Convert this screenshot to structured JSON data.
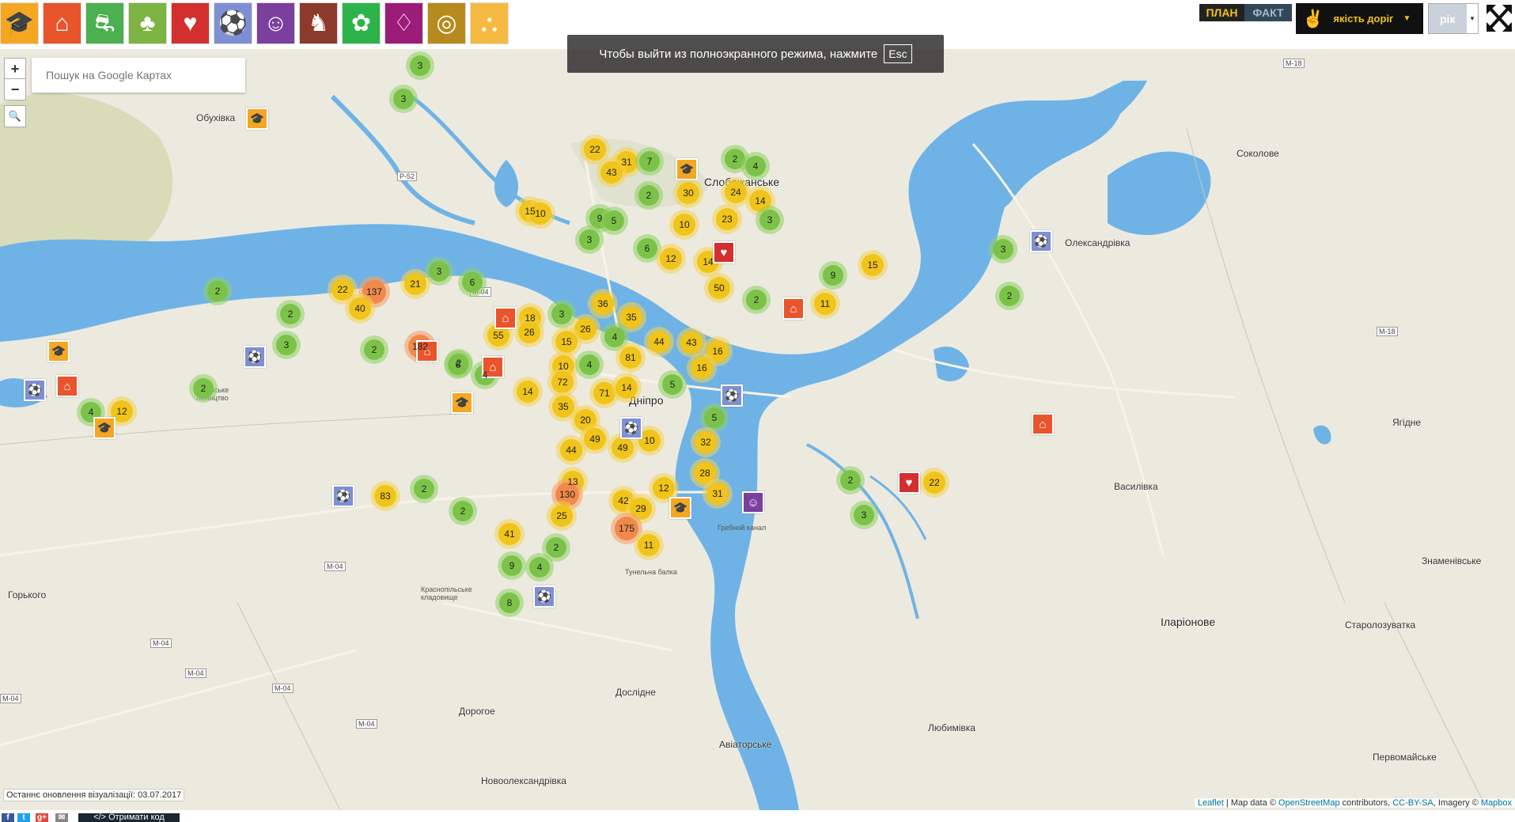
{
  "categories": [
    {
      "name": "education",
      "icon": "education-icon",
      "color": "#f5a623"
    },
    {
      "name": "housing",
      "icon": "house-repair-icon",
      "color": "#e8542b"
    },
    {
      "name": "roads",
      "icon": "road-icon",
      "color": "#4caf50"
    },
    {
      "name": "parks",
      "icon": "park-icon",
      "color": "#7cb342"
    },
    {
      "name": "health",
      "icon": "heart-icon",
      "color": "#d32f2f"
    },
    {
      "name": "sport",
      "icon": "ball-icon",
      "color": "#7e8fd6"
    },
    {
      "name": "culture",
      "icon": "theater-masks-icon",
      "color": "#7b3f9e"
    },
    {
      "name": "monuments",
      "icon": "horse-monument-icon",
      "color": "#8b3a2b"
    },
    {
      "name": "ecology",
      "icon": "plant-icon",
      "color": "#2db34a"
    },
    {
      "name": "lighting",
      "icon": "street-lamp-icon",
      "color": "#9c1c7a"
    },
    {
      "name": "utilities",
      "icon": "meter-icon",
      "color": "#b78a1e"
    },
    {
      "name": "playgrounds",
      "icon": "playground-icon",
      "color": "#f5b942"
    }
  ],
  "toggle": {
    "plan": "ПЛАН",
    "fact": "ФАКТ"
  },
  "roads_quality": {
    "label": "якість доріг"
  },
  "year_select": {
    "value": "рік"
  },
  "fullscreen_notice": {
    "text": "Чтобы выйти из полноэкранного режима, нажмите",
    "key": "Esc"
  },
  "zoom": {
    "in": "+",
    "out": "−"
  },
  "search": {
    "placeholder": "Пошук на Google Картах"
  },
  "places": [
    {
      "t": "Обухівка",
      "c": "village"
    },
    {
      "t": "Слобожанське",
      "c": "city"
    },
    {
      "t": "Дніпро",
      "c": "city"
    },
    {
      "t": "Соколове",
      "c": "village"
    },
    {
      "t": "Олександрівка",
      "c": "village"
    },
    {
      "t": "Ягідне",
      "c": "village"
    },
    {
      "t": "Василівка",
      "c": "village"
    },
    {
      "t": "Знаменівське",
      "c": "village"
    },
    {
      "t": "Іларіонове",
      "c": "city"
    },
    {
      "t": "Старолозуватка",
      "c": "village"
    },
    {
      "t": "Горького",
      "c": "village"
    },
    {
      "t": "Дорогое",
      "c": "village"
    },
    {
      "t": "Дослідне",
      "c": "village"
    },
    {
      "t": "Авіаторське",
      "c": "village"
    },
    {
      "t": "Новоолександрівка",
      "c": "village"
    },
    {
      "t": "Любимівка",
      "c": "village"
    },
    {
      "t": "Первомайське",
      "c": "village"
    },
    {
      "t": "Ленінське лісництво",
      "c": "small"
    },
    {
      "t": "Гребной канал",
      "c": "small"
    },
    {
      "t": "Тунельна балка",
      "c": "small"
    },
    {
      "t": "Краснопільське кладовище",
      "c": "small"
    }
  ],
  "road_labels": [
    "M-18",
    "M-18",
    "P-52",
    "M-04",
    "M-04",
    "M-04",
    "M-04",
    "M-04",
    "M-04",
    "M-04"
  ],
  "clusters": [
    {
      "n": "3",
      "k": "g"
    },
    {
      "n": "3",
      "k": "g"
    },
    {
      "n": "22",
      "k": "y"
    },
    {
      "n": "31",
      "k": "y"
    },
    {
      "n": "43",
      "k": "y"
    },
    {
      "n": "7",
      "k": "g"
    },
    {
      "n": "2",
      "k": "g"
    },
    {
      "n": "4",
      "k": "g"
    },
    {
      "n": "2",
      "k": "g"
    },
    {
      "n": "30",
      "k": "y"
    },
    {
      "n": "24",
      "k": "y"
    },
    {
      "n": "14",
      "k": "y"
    },
    {
      "n": "10",
      "k": "y"
    },
    {
      "n": "15",
      "k": "y"
    },
    {
      "n": "9",
      "k": "g"
    },
    {
      "n": "5",
      "k": "g"
    },
    {
      "n": "10",
      "k": "y"
    },
    {
      "n": "23",
      "k": "y"
    },
    {
      "n": "3",
      "k": "g"
    },
    {
      "n": "3",
      "k": "g"
    },
    {
      "n": "6",
      "k": "g"
    },
    {
      "n": "12",
      "k": "y"
    },
    {
      "n": "14",
      "k": "y"
    },
    {
      "n": "15",
      "k": "y"
    },
    {
      "n": "9",
      "k": "g"
    },
    {
      "n": "50",
      "k": "y"
    },
    {
      "n": "2",
      "k": "g"
    },
    {
      "n": "11",
      "k": "y"
    },
    {
      "n": "3",
      "k": "g"
    },
    {
      "n": "6",
      "k": "g"
    },
    {
      "n": "22",
      "k": "y"
    },
    {
      "n": "137",
      "k": "o"
    },
    {
      "n": "21",
      "k": "y"
    },
    {
      "n": "40",
      "k": "y"
    },
    {
      "n": "2",
      "k": "g"
    },
    {
      "n": "2",
      "k": "g"
    },
    {
      "n": "3",
      "k": "g"
    },
    {
      "n": "2",
      "k": "g"
    },
    {
      "n": "182",
      "k": "o"
    },
    {
      "n": "2",
      "k": "g"
    },
    {
      "n": "12",
      "k": "y"
    },
    {
      "n": "2",
      "k": "g"
    },
    {
      "n": "18",
      "k": "y"
    },
    {
      "n": "55",
      "k": "y"
    },
    {
      "n": "26",
      "k": "y"
    },
    {
      "n": "3",
      "k": "g"
    },
    {
      "n": "26",
      "k": "y"
    },
    {
      "n": "36",
      "k": "y"
    },
    {
      "n": "35",
      "k": "y"
    },
    {
      "n": "15",
      "k": "y"
    },
    {
      "n": "4",
      "k": "g"
    },
    {
      "n": "44",
      "k": "y"
    },
    {
      "n": "43",
      "k": "y"
    },
    {
      "n": "16",
      "k": "y"
    },
    {
      "n": "6",
      "k": "g"
    },
    {
      "n": "4",
      "k": "g"
    },
    {
      "n": "10",
      "k": "y"
    },
    {
      "n": "4",
      "k": "g"
    },
    {
      "n": "81",
      "k": "y"
    },
    {
      "n": "16",
      "k": "y"
    },
    {
      "n": "72",
      "k": "y"
    },
    {
      "n": "14",
      "k": "y"
    },
    {
      "n": "71",
      "k": "y"
    },
    {
      "n": "14",
      "k": "y"
    },
    {
      "n": "5",
      "k": "g"
    },
    {
      "n": "35",
      "k": "y"
    },
    {
      "n": "20",
      "k": "y"
    },
    {
      "n": "5",
      "k": "g"
    },
    {
      "n": "49",
      "k": "y"
    },
    {
      "n": "10",
      "k": "y"
    },
    {
      "n": "44",
      "k": "y"
    },
    {
      "n": "49",
      "k": "y"
    },
    {
      "n": "32",
      "k": "y"
    },
    {
      "n": "28",
      "k": "y"
    },
    {
      "n": "13",
      "k": "y"
    },
    {
      "n": "130",
      "k": "o"
    },
    {
      "n": "12",
      "k": "y"
    },
    {
      "n": "42",
      "k": "y"
    },
    {
      "n": "29",
      "k": "y"
    },
    {
      "n": "31",
      "k": "y"
    },
    {
      "n": "25",
      "k": "y"
    },
    {
      "n": "175",
      "k": "o"
    },
    {
      "n": "11",
      "k": "y"
    },
    {
      "n": "41",
      "k": "y"
    },
    {
      "n": "2",
      "k": "g"
    },
    {
      "n": "9",
      "k": "g"
    },
    {
      "n": "4",
      "k": "g"
    },
    {
      "n": "8",
      "k": "g"
    },
    {
      "n": "4",
      "k": "g"
    },
    {
      "n": "2",
      "k": "g"
    },
    {
      "n": "2",
      "k": "g"
    },
    {
      "n": "83",
      "k": "y"
    },
    {
      "n": "2",
      "k": "g"
    },
    {
      "n": "22",
      "k": "y"
    },
    {
      "n": "3",
      "k": "g"
    },
    {
      "n": "3",
      "k": "g"
    },
    {
      "n": "2",
      "k": "g"
    }
  ],
  "markers": [
    {
      "icon": "education-icon",
      "color": "#f5a623",
      "glyph": "🎓"
    },
    {
      "icon": "education-icon",
      "color": "#f5a623",
      "glyph": "🎓"
    },
    {
      "icon": "education-icon",
      "color": "#f5a623",
      "glyph": "🎓"
    },
    {
      "icon": "education-icon",
      "color": "#f5a623",
      "glyph": "🎓"
    },
    {
      "icon": "education-icon",
      "color": "#f5a623",
      "glyph": "🎓"
    },
    {
      "icon": "education-icon",
      "color": "#f5a623",
      "glyph": "🎓"
    },
    {
      "icon": "house-repair-icon",
      "color": "#e8542b",
      "glyph": "⌂"
    },
    {
      "icon": "house-repair-icon",
      "color": "#e8542b",
      "glyph": "⌂"
    },
    {
      "icon": "house-repair-icon",
      "color": "#e8542b",
      "glyph": "⌂"
    },
    {
      "icon": "house-repair-icon",
      "color": "#e8542b",
      "glyph": "⌂"
    },
    {
      "icon": "house-repair-icon",
      "color": "#e8542b",
      "glyph": "⌂"
    },
    {
      "icon": "house-repair-icon",
      "color": "#e8542b",
      "glyph": "⌂"
    },
    {
      "icon": "heart-icon",
      "color": "#d32f2f",
      "glyph": "♥"
    },
    {
      "icon": "heart-icon",
      "color": "#d32f2f",
      "glyph": "♥"
    },
    {
      "icon": "ball-icon",
      "color": "#7e8fd6",
      "glyph": "⚽"
    },
    {
      "icon": "ball-icon",
      "color": "#7e8fd6",
      "glyph": "⚽"
    },
    {
      "icon": "ball-icon",
      "color": "#7e8fd6",
      "glyph": "⚽"
    },
    {
      "icon": "ball-icon",
      "color": "#7e8fd6",
      "glyph": "⚽"
    },
    {
      "icon": "ball-icon",
      "color": "#7e8fd6",
      "glyph": "⚽"
    },
    {
      "icon": "ball-icon",
      "color": "#7e8fd6",
      "glyph": "⚽"
    },
    {
      "icon": "ball-icon",
      "color": "#7e8fd6",
      "glyph": "⚽"
    },
    {
      "icon": "theater-masks-icon",
      "color": "#7b3f9e",
      "glyph": "☺"
    }
  ],
  "updated": "Останнє оновлення візуалізації: 03.07.2017",
  "attribution": {
    "leaflet": "Leaflet",
    "mapdata": " | Map data © ",
    "osm": "OpenStreetMap",
    "contrib": " contributors, ",
    "cc": "CC-BY-SA",
    "imagery": ", Imagery © ",
    "mapbox": "Mapbox"
  },
  "footer": {
    "share_facebook": "f",
    "share_twitter": "t",
    "share_google": "g+",
    "share_email": "✉",
    "get_code": "</> Отримати код"
  }
}
